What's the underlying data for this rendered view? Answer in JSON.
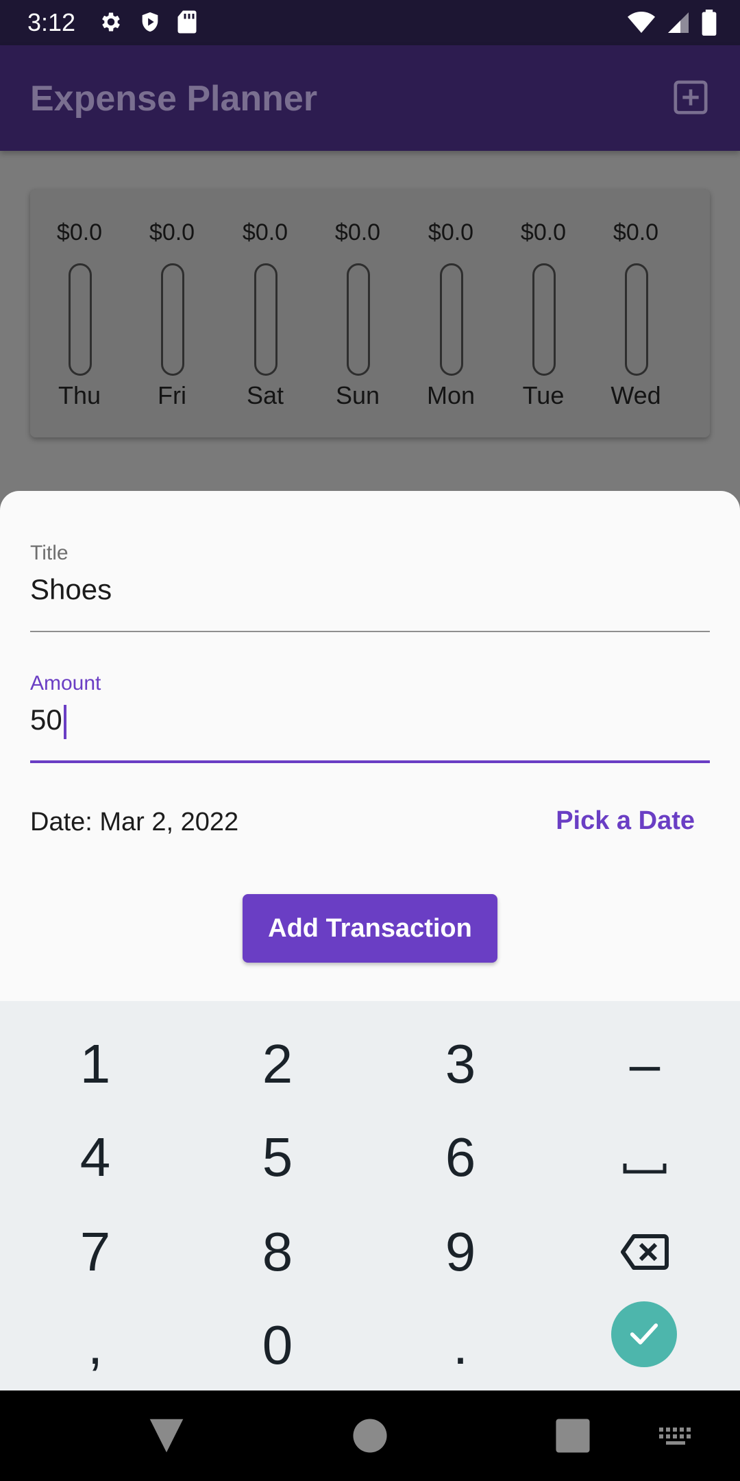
{
  "status_bar": {
    "time": "3:12",
    "left_icons": [
      "settings-icon",
      "shield-icon",
      "sd-card-icon"
    ],
    "right_icons": [
      "wifi-icon",
      "signal-icon",
      "battery-icon"
    ]
  },
  "app_bar": {
    "title": "Expense Planner",
    "action_icon": "add-box-icon"
  },
  "chart_data": {
    "type": "bar",
    "categories": [
      "Thu",
      "Fri",
      "Sat",
      "Sun",
      "Mon",
      "Tue",
      "Wed"
    ],
    "amount_labels": [
      "$0.0",
      "$0.0",
      "$0.0",
      "$0.0",
      "$0.0",
      "$0.0",
      "$0.0"
    ],
    "values": [
      0,
      0,
      0,
      0,
      0,
      0,
      0
    ],
    "fill_fraction": [
      0,
      0,
      0,
      0,
      0,
      0,
      0
    ]
  },
  "form": {
    "title_label": "Title",
    "title_value": "Shoes",
    "amount_label": "Amount",
    "amount_value": "50",
    "date_text": "Date: Mar 2, 2022",
    "pick_date_label": "Pick a Date",
    "submit_label": "Add Transaction"
  },
  "keyboard": {
    "rows": [
      [
        "1",
        "2",
        "3",
        "–"
      ],
      [
        "4",
        "5",
        "6",
        "space"
      ],
      [
        "7",
        "8",
        "9",
        "backspace"
      ],
      [
        ",",
        "0",
        ".",
        "done"
      ]
    ],
    "labels": {
      "k1": "1",
      "k2": "2",
      "k3": "3",
      "dash": "–",
      "k4": "4",
      "k5": "5",
      "k6": "6",
      "k7": "7",
      "k8": "8",
      "k9": "9",
      "comma": ",",
      "k0": "0",
      "period": "."
    }
  },
  "colors": {
    "accent": "#6a3ec4",
    "app_bar": "#2d1c50",
    "status_bar": "#1d1633",
    "keyboard_bg": "#eceff1",
    "done_key": "#4db6ac"
  }
}
